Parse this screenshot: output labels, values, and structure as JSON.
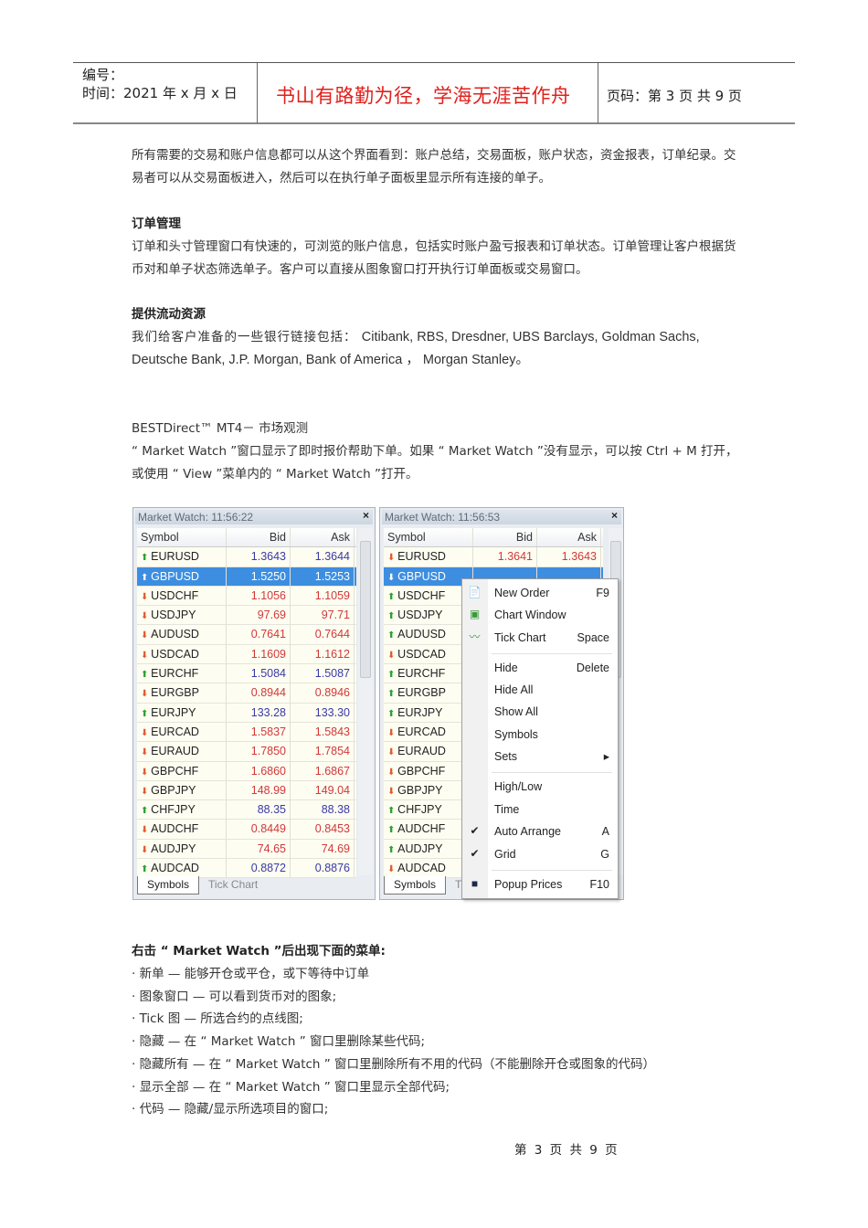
{
  "header": {
    "number_label": "编号：",
    "date_label": "时间：2021 年 x 月 x 日",
    "motto": "书山有路勤为径，学海无涯苦作舟",
    "page_label": "页码：第 3 页 共 9 页"
  },
  "para1": "所有需要的交易和账户信息都可以从这个界面看到：账户总结，交易面板，账户状态，资金报表，订单纪录。交易者可以从交易面板进入，然后可以在执行单子面板里显示所有连接的单子。",
  "h_order": "订单管理",
  "para2": "订单和头寸管理窗口有快速的，可浏览的账户信息，包括实时账户盈亏报表和订单状态。订单管理让客户根据货币对和单子状态筛选单子。客户可以直接从图象窗口打开执行订单面板或交易窗口。",
  "h_liq": "提供流动资源",
  "para3a": "我们给客户准备的一些银行链接包括：",
  "para3b": "Citibank, RBS, Dresdner, UBS Barclays, Goldman Sachs, Deutsche Bank, J.P. Morgan, Bank of America ， Morgan Stanley。",
  "mt4_title": "BESTDirect™ MT4－ 市场观测",
  "para4": "“ Market Watch ”窗口显示了即时报价帮助下单。如果 “ Market Watch ”没有显示，可以按 Ctrl + M 打开，或使用 “ View ”菜单内的 “ Market Watch ”打开。",
  "panels": [
    {
      "title": "Market Watch: 11:56:22",
      "cols": [
        "Symbol",
        "Bid",
        "Ask"
      ],
      "tabs": [
        "Symbols",
        "Tick Chart"
      ],
      "rows": [
        [
          "EURUSD",
          "up",
          "1.3643",
          "1.3644"
        ],
        [
          "GBPUSD",
          "up",
          "1.5250",
          "1.5253"
        ],
        [
          "USDCHF",
          "dn",
          "1.1056",
          "1.1059"
        ],
        [
          "USDJPY",
          "dn",
          "97.69",
          "97.71"
        ],
        [
          "AUDUSD",
          "dn",
          "0.7641",
          "0.7644"
        ],
        [
          "USDCAD",
          "dn",
          "1.1609",
          "1.1612"
        ],
        [
          "EURCHF",
          "up",
          "1.5084",
          "1.5087"
        ],
        [
          "EURGBP",
          "dn",
          "0.8944",
          "0.8946"
        ],
        [
          "EURJPY",
          "up",
          "133.28",
          "133.30"
        ],
        [
          "EURCAD",
          "dn",
          "1.5837",
          "1.5843"
        ],
        [
          "EURAUD",
          "dn",
          "1.7850",
          "1.7854"
        ],
        [
          "GBPCHF",
          "dn",
          "1.6860",
          "1.6867"
        ],
        [
          "GBPJPY",
          "dn",
          "148.99",
          "149.04"
        ],
        [
          "CHFJPY",
          "up",
          "88.35",
          "88.38"
        ],
        [
          "AUDCHF",
          "dn",
          "0.8449",
          "0.8453"
        ],
        [
          "AUDJPY",
          "dn",
          "74.65",
          "74.69"
        ],
        [
          "AUDCAD",
          "up",
          "0.8872",
          "0.8876"
        ]
      ]
    },
    {
      "title": "Market Watch: 11:56:53",
      "cols": [
        "Symbol",
        "Bid",
        "Ask"
      ],
      "tabs": [
        "Symbols",
        "Ti"
      ],
      "rows": [
        [
          "EURUSD",
          "dn",
          "1.3641",
          "1.3643"
        ],
        [
          "GBPUSD",
          "dn",
          "",
          ""
        ],
        [
          "USDCHF",
          "up",
          "",
          ""
        ],
        [
          "USDJPY",
          "up",
          "",
          ""
        ],
        [
          "AUDUSD",
          "up",
          "",
          ""
        ],
        [
          "USDCAD",
          "dn",
          "",
          ""
        ],
        [
          "EURCHF",
          "up",
          "",
          ""
        ],
        [
          "EURGBP",
          "up",
          "",
          ""
        ],
        [
          "EURJPY",
          "up",
          "",
          ""
        ],
        [
          "EURCAD",
          "dn",
          "",
          ""
        ],
        [
          "EURAUD",
          "dn",
          "",
          ""
        ],
        [
          "GBPCHF",
          "dn",
          "",
          ""
        ],
        [
          "GBPJPY",
          "dn",
          "",
          ""
        ],
        [
          "CHFJPY",
          "up",
          "",
          ""
        ],
        [
          "AUDCHF",
          "up",
          "",
          ""
        ],
        [
          "AUDJPY",
          "up",
          "",
          ""
        ],
        [
          "AUDCAD",
          "dn",
          "",
          ""
        ]
      ]
    }
  ],
  "menu": [
    {
      "label": "New Order",
      "key": "F9",
      "icon": "new-order-icon"
    },
    {
      "label": "Chart Window",
      "key": "",
      "icon": "chart-window-icon"
    },
    {
      "label": "Tick Chart",
      "key": "Space",
      "icon": "tick-chart-icon"
    },
    {
      "sep": true
    },
    {
      "label": "Hide",
      "key": "Delete"
    },
    {
      "label": "Hide All",
      "key": ""
    },
    {
      "label": "Show All",
      "key": ""
    },
    {
      "label": "Symbols",
      "key": ""
    },
    {
      "label": "Sets",
      "key": "▸"
    },
    {
      "sep": true
    },
    {
      "label": "High/Low",
      "key": ""
    },
    {
      "label": "Time",
      "key": ""
    },
    {
      "label": "Auto Arrange",
      "key": "A",
      "check": true
    },
    {
      "label": "Grid",
      "key": "G",
      "check": true
    },
    {
      "sep": true
    },
    {
      "label": "Popup Prices",
      "key": "F10",
      "icon": "popup-prices-icon"
    }
  ],
  "h_right": "右击 “ Market Watch ”后出现下面的菜单:",
  "bullets": [
    "· 新单 — 能够开仓或平仓，或下等待中订单",
    "· 图象窗口 — 可以看到货币对的图象;",
    "· Tick 图 — 所选合约的点线图;",
    "· 隐藏 — 在 “ Market Watch ” 窗口里删除某些代码;",
    "· 隐藏所有 — 在 “ Market Watch ” 窗口里删除所有不用的代码（不能删除开仓或图象的代码）",
    "· 显示全部 — 在 “ Market Watch ” 窗口里显示全部代码;",
    "· 代码 — 隐藏/显示所选项目的窗口;"
  ],
  "footer": "第 3 页 共 9 页"
}
